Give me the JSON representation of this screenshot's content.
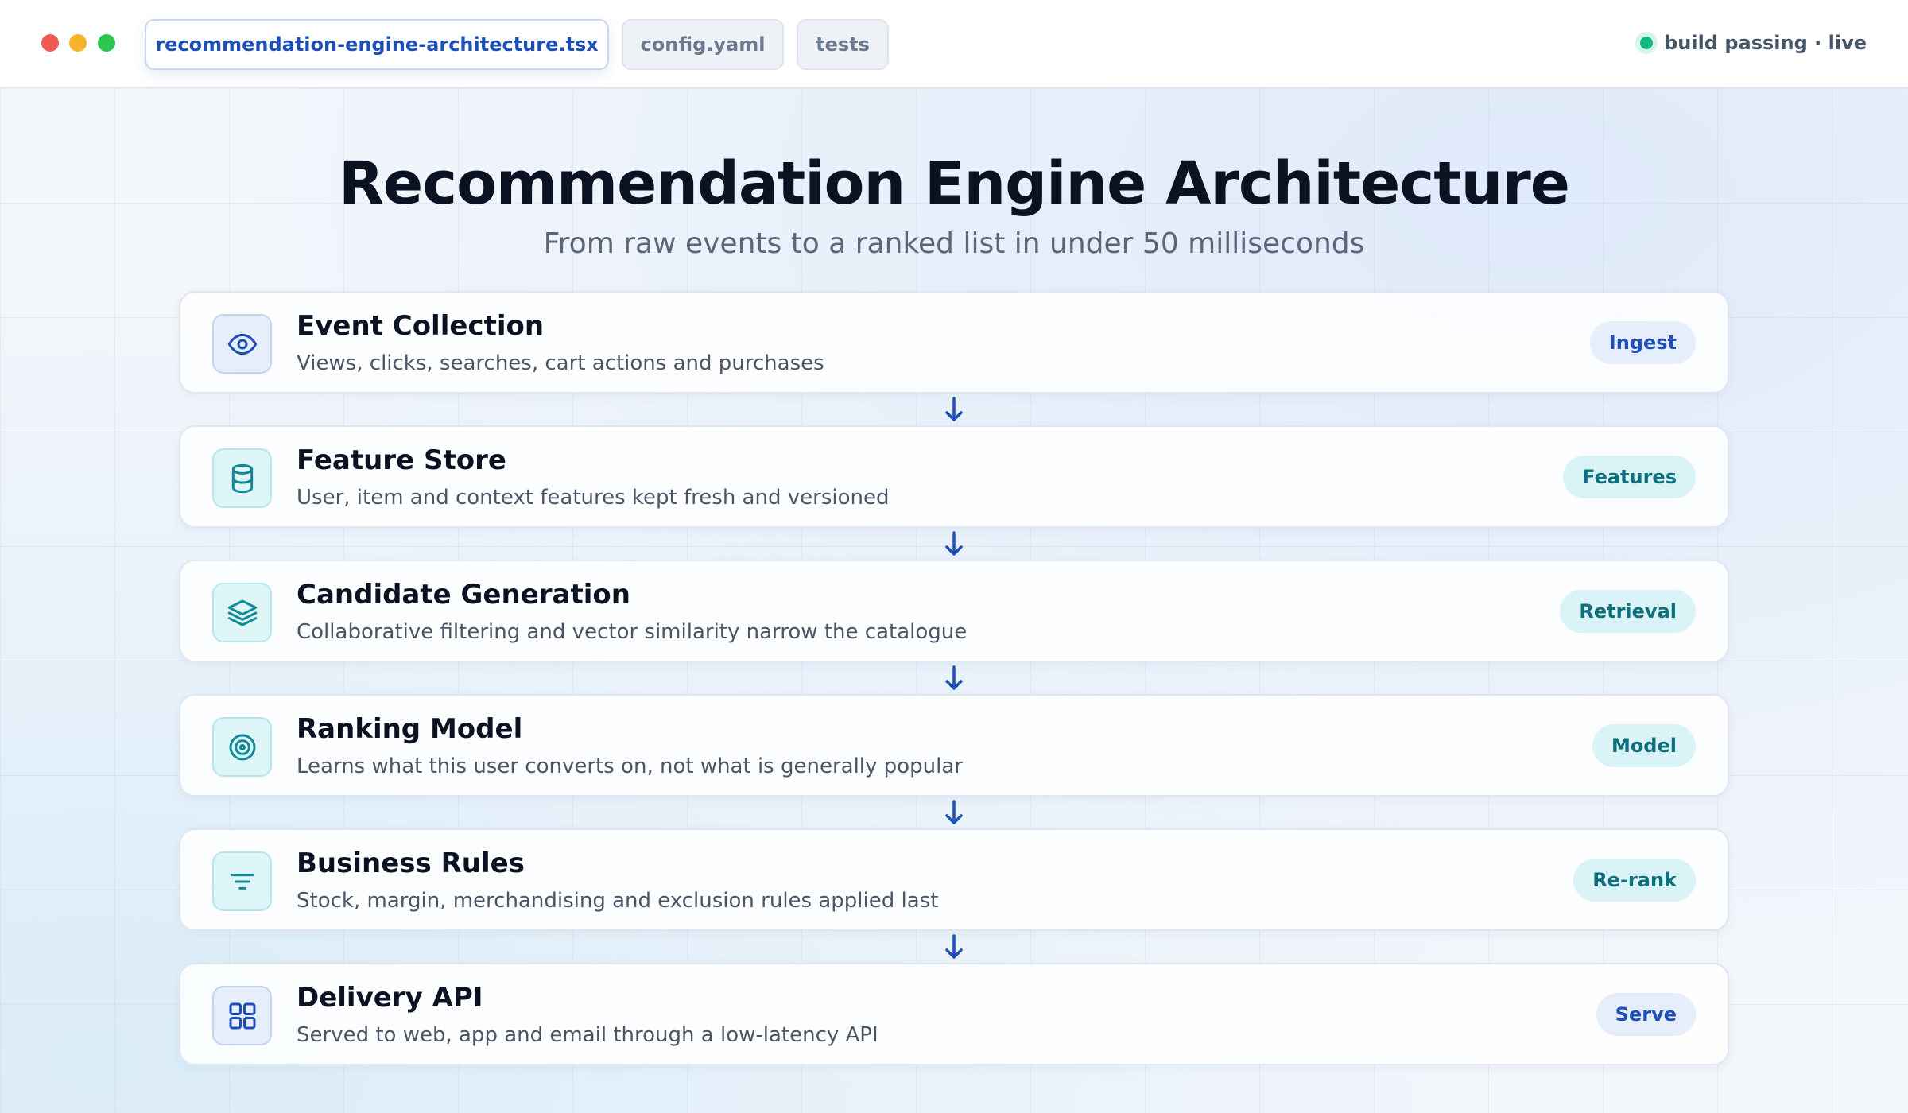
{
  "window": {
    "tabs": [
      {
        "label": "recommendation-engine-architecture.tsx"
      },
      {
        "label": "config.yaml"
      },
      {
        "label": "tests"
      }
    ],
    "status": "build passing · live"
  },
  "diagram": {
    "title": "Recommendation Engine Architecture",
    "subtitle": "From raw events to a ranked list in under 50 milliseconds",
    "stages": [
      {
        "title": "Event Collection",
        "description": "Views, clicks, searches, cart actions and purchases",
        "badge": "Ingest",
        "icon": "eye-icon"
      },
      {
        "title": "Feature Store",
        "description": "User, item and context features kept fresh and versioned",
        "badge": "Features",
        "icon": "database-icon"
      },
      {
        "title": "Candidate Generation",
        "description": "Collaborative filtering and vector similarity narrow the catalogue",
        "badge": "Retrieval",
        "icon": "layers-icon"
      },
      {
        "title": "Ranking Model",
        "description": "Learns what this user converts on, not what is generally popular",
        "badge": "Model",
        "icon": "target-icon"
      },
      {
        "title": "Business Rules",
        "description": "Stock, margin, merchandising and exclusion rules applied last",
        "badge": "Re-rank",
        "icon": "filter-icon"
      },
      {
        "title": "Delivery API",
        "description": "Served to web, app and email through a low-latency API",
        "badge": "Serve",
        "icon": "grid-icon"
      }
    ]
  },
  "colors": {
    "accent_blue": "#1d4fb8",
    "accent_teal": "#0e7c8a",
    "status_green": "#10b981"
  }
}
